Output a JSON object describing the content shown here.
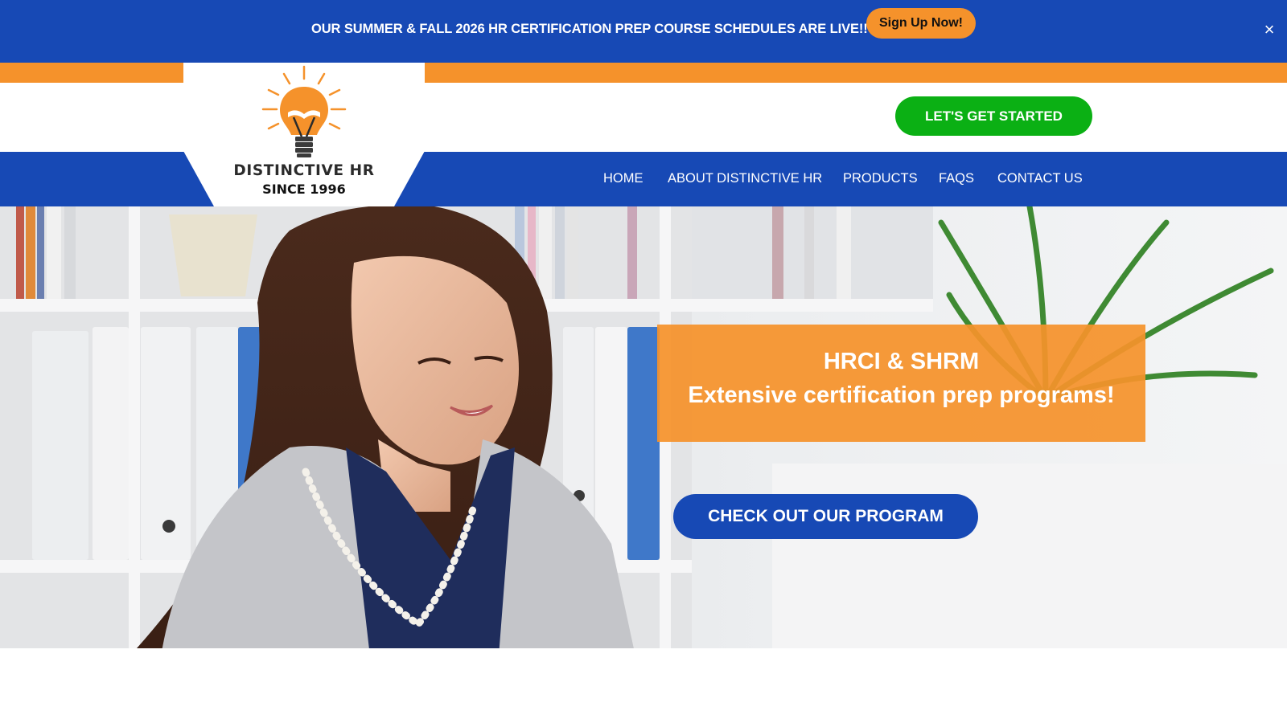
{
  "announcement": {
    "text": "OUR SUMMER & FALL 2026 HR CERTIFICATION PREP COURSE SCHEDULES ARE LIVE!!",
    "button_label": "Sign Up Now!",
    "close_label": "×"
  },
  "header": {
    "logo": {
      "name": "DISTINCTIVE HR",
      "since": "SINCE 1996",
      "icon": "lightbulb-book-icon"
    },
    "cta_label": "LET'S GET STARTED"
  },
  "nav": {
    "items": [
      {
        "label": "HOME"
      },
      {
        "label": "ABOUT DISTINCTIVE HR"
      },
      {
        "label": "PRODUCTS"
      },
      {
        "label": "FAQS"
      },
      {
        "label": "CONTACT US"
      }
    ]
  },
  "hero": {
    "headline": "HRCI & SHRM",
    "subheadline": "Extensive certification prep programs!",
    "cta_label": "CHECK OUT OUR PROGRAM"
  },
  "colors": {
    "brand_blue": "#1749b5",
    "brand_orange": "#f5922b",
    "cta_green": "#0bb014"
  }
}
